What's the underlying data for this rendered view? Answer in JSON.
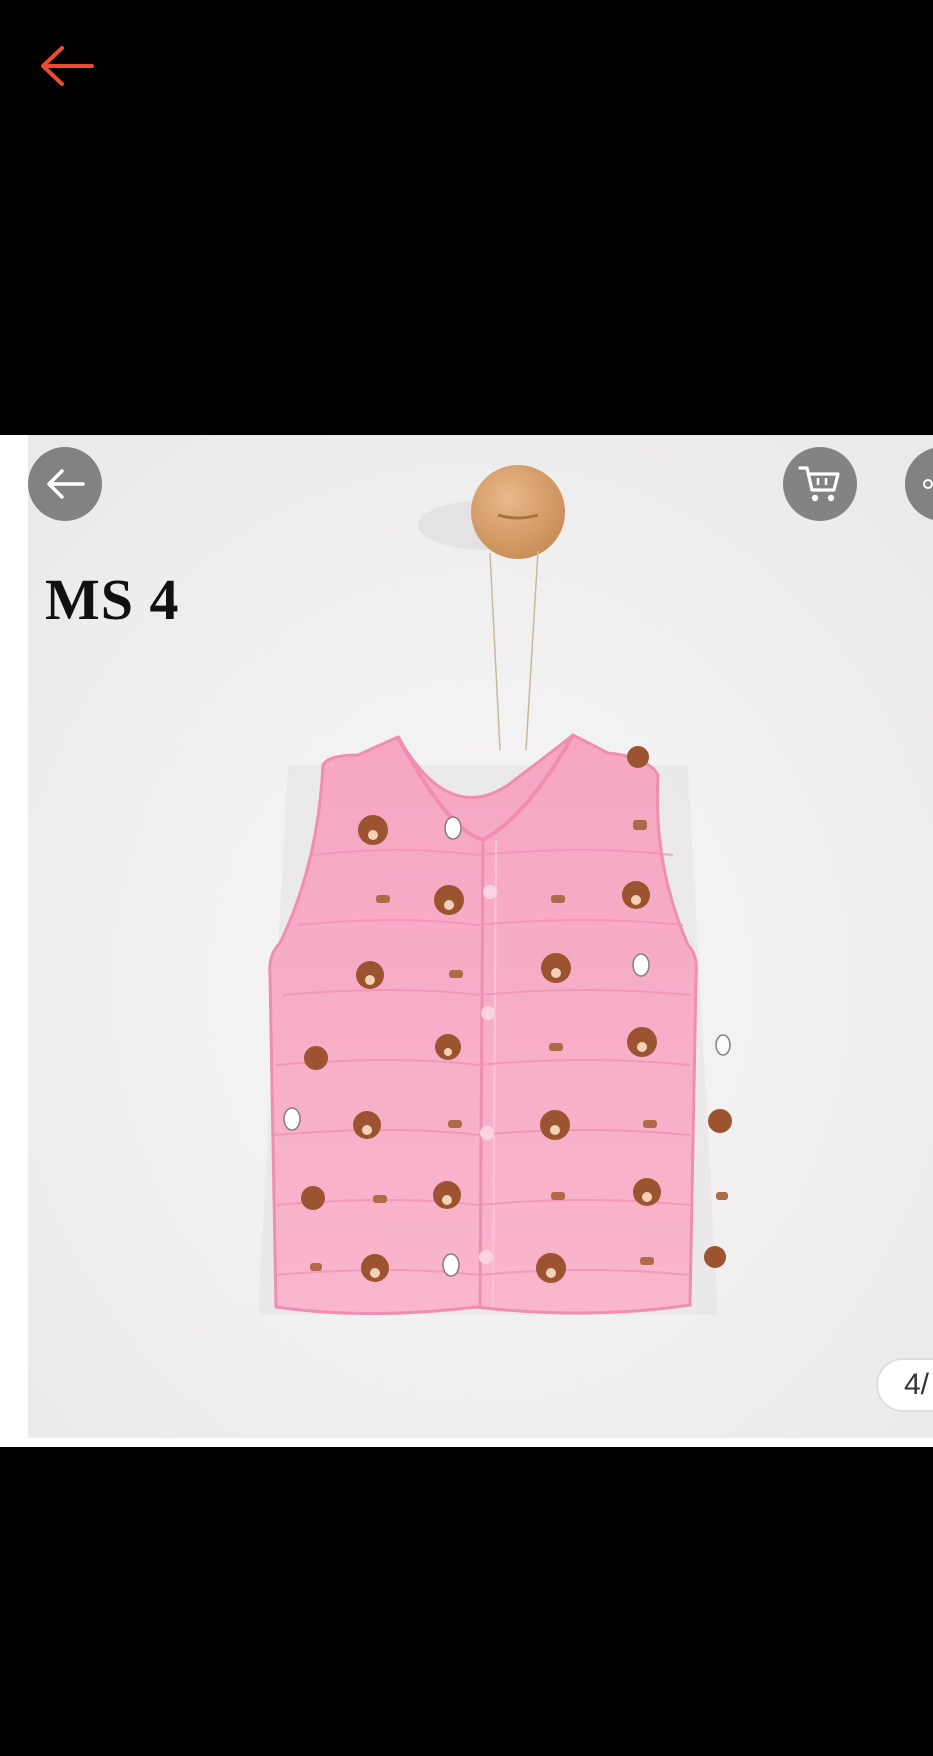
{
  "top_bar": {
    "back_icon": "arrow-left-icon",
    "back_color": "#ee4d2d"
  },
  "gallery": {
    "overlay_back_icon": "arrow-left-icon",
    "cart_icon": "cart-icon",
    "more_icon": "more-icon",
    "pager_text": "4/",
    "image_label": "MS 4",
    "product_color": "#f7a9c4"
  }
}
